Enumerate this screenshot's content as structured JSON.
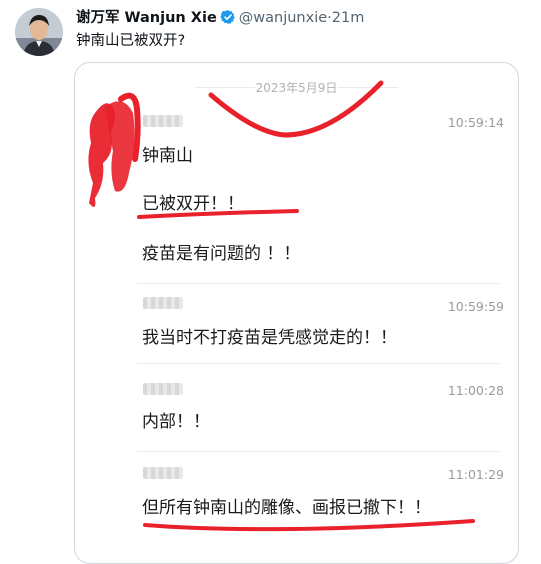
{
  "tweet": {
    "author_name": "谢万军 Wanjun Xie",
    "handle": "@wanjunxie",
    "separator": "·",
    "time": "21m",
    "text": "钟南山已被双开?"
  },
  "screenshot": {
    "date": "2023年5月9日",
    "messages": [
      {
        "time": "10:59:14",
        "lines": [
          "钟南山",
          "已被双开！！",
          "疫苗是有问题的 ！！"
        ]
      },
      {
        "time": "10:59:59",
        "lines": [
          "我当时不打疫苗是凭感觉走的！！"
        ]
      },
      {
        "time": "11:00:28",
        "lines": [
          "内部！！"
        ]
      },
      {
        "time": "11:01:29",
        "lines": [
          "但所有钟南山的雕像、画报已撤下！！"
        ]
      }
    ]
  },
  "colors": {
    "annotation_red": "#e8212b",
    "verified_blue": "#1d9bf0"
  }
}
